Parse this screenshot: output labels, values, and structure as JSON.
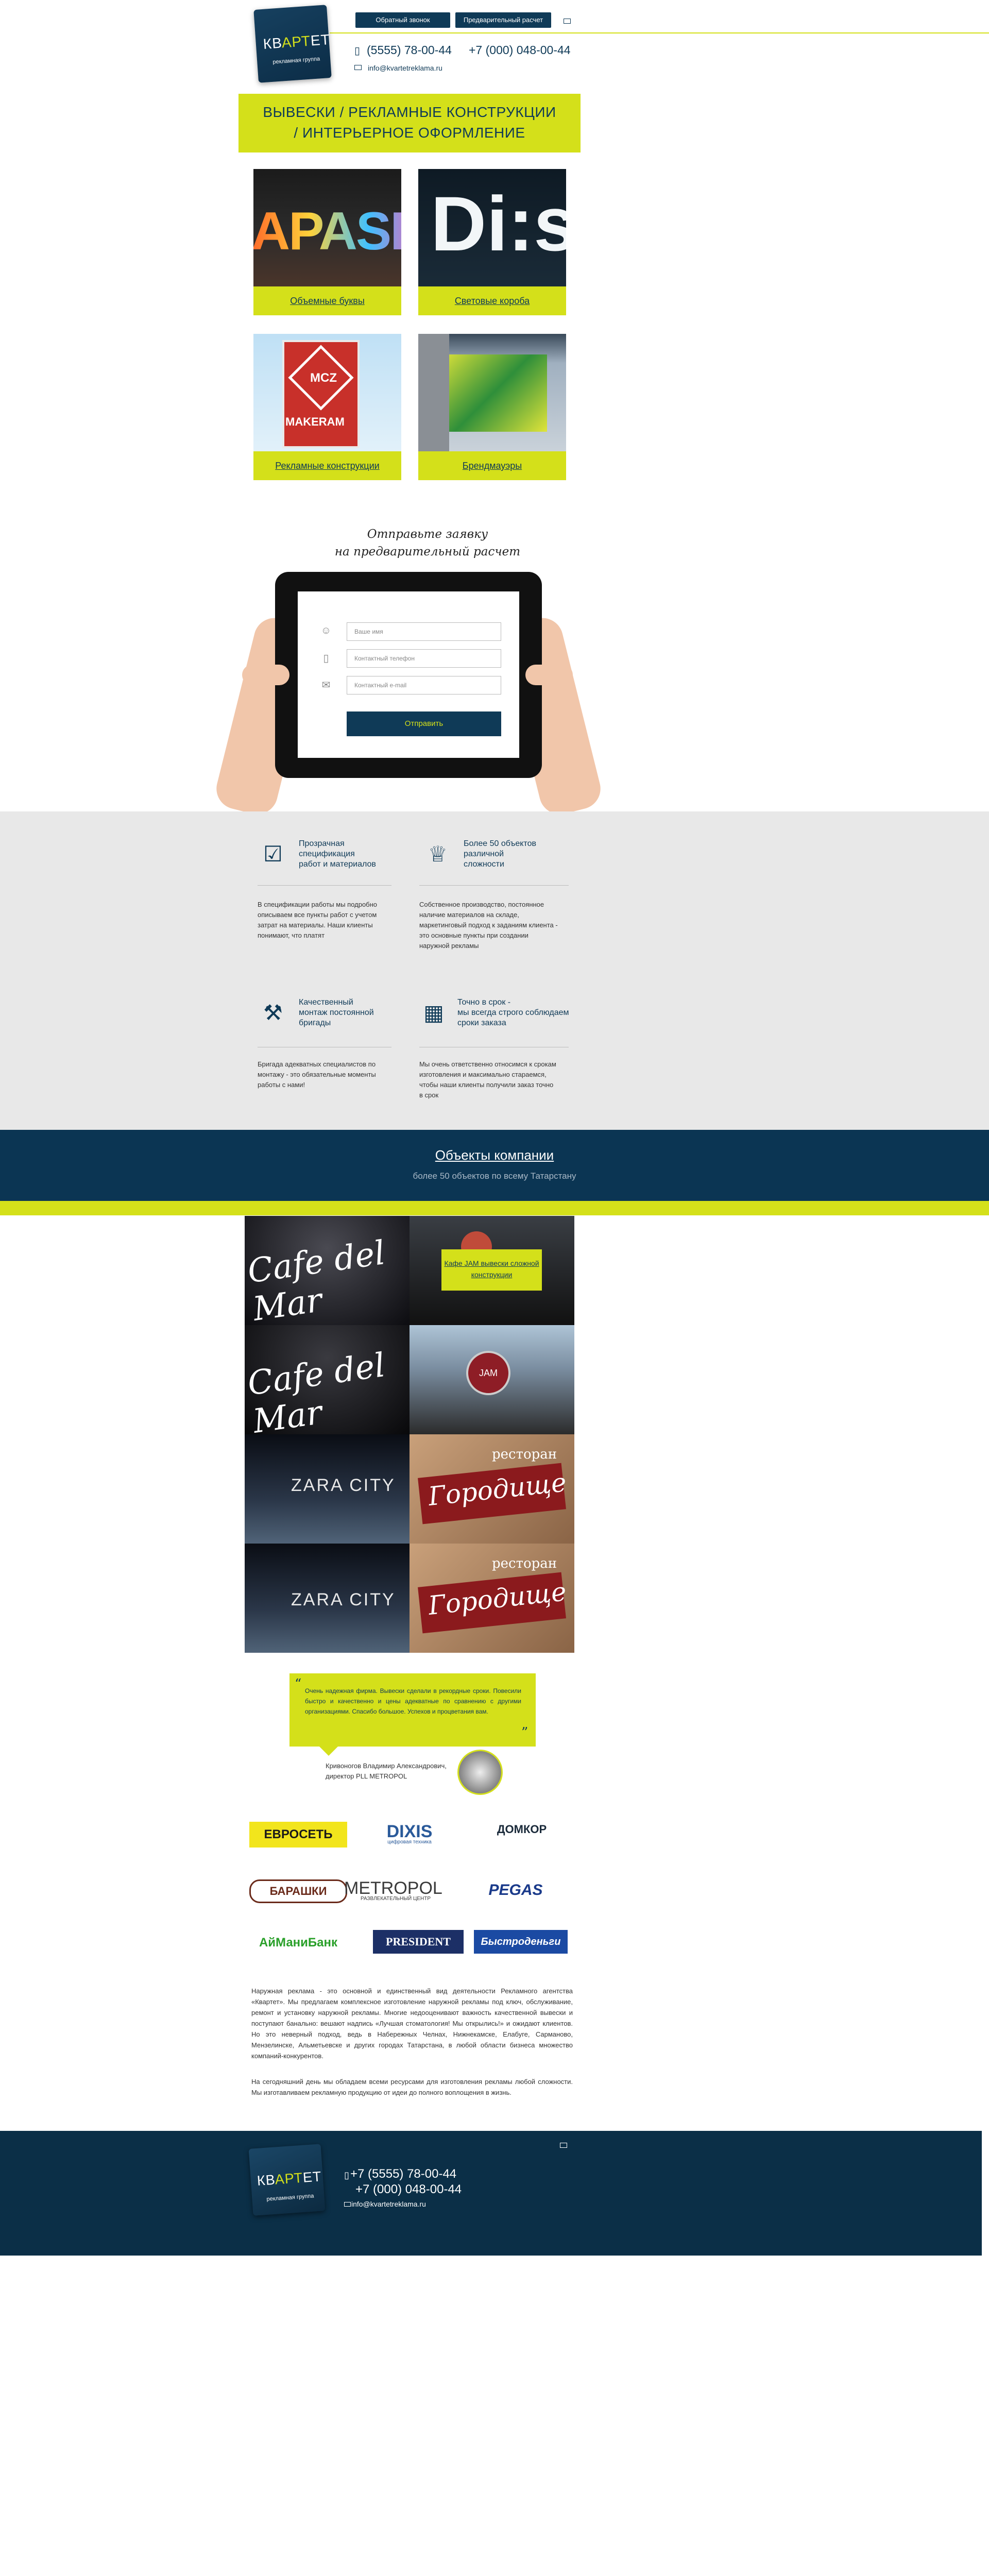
{
  "header": {
    "logo_word_a": "КВ",
    "logo_word_b": "АРТ",
    "logo_word_c": "ЕТ",
    "logo_sub": "рекламная группа",
    "callback_label": "Обратный звонок",
    "calc_label": "Предварительный расчет",
    "phone1": "(5555) 78-00-44",
    "phone2": "+7 (000) 048-00-44",
    "email": "info@kvartetreklama.ru",
    "mail_icon": "envelope-icon",
    "phone_icon": "phone-icon"
  },
  "banner": {
    "line1": "ВЫВЕСКИ  /  РЕКЛАМНЫЕ КОНСТРУКЦИИ",
    "line2": "/  ИНТЕРЬЕРНОЕ ОФОРМЛЕНИЕ"
  },
  "tiles": [
    {
      "label": "Объемные буквы",
      "text": "APASH"
    },
    {
      "label": "Световые короба",
      "text": "Di:s"
    },
    {
      "label": "Рекламные конструкции",
      "text": "MAKERAM"
    },
    {
      "label": "Брендмауэры",
      "text": ""
    }
  ],
  "form": {
    "title1": "Отправьте заявку",
    "title2": "на предварительный расчет",
    "name_placeholder": "Ваше имя",
    "phone_placeholder": "Контактный телефон",
    "email_placeholder": "Контактный e-mail",
    "submit_label": "Отправить"
  },
  "features": [
    {
      "title": "Прозрачная\nспецификация\nработ и материалов",
      "text": "В спецификации работы мы подробно описываем все пункты работ с учетом затрат на материалы. Наши клиенты понимают, что платят",
      "icon": "checklist-icon"
    },
    {
      "title": "Более 50 объектов\nразличной\nсложности",
      "text": "Собственное производство, постоянное наличие материалов на складе, маркетинговый подход к заданиям клиента - это основные пункты при создании наружной рекламы",
      "icon": "trophy-icon"
    },
    {
      "title": "Качественный\nмонтаж постоянной\nбригады",
      "text": "Бригада адекватных специалистов по монтажу - это обязательные моменты работы с нами!",
      "icon": "crane-icon"
    },
    {
      "title": "Точно в срок -\nмы всегда строго соблюдаем\nсроки заказа",
      "text": "Мы очень ответственно относимся к срокам изготовления и максимально стараемся, чтобы наши клиенты получили заказ точно в срок",
      "icon": "calendar-icon"
    }
  ],
  "objects": {
    "title": "Объекты компании",
    "subtitle": "более 50 объектов по всему Татарстану",
    "highlight_label": "Кафе JAM вывески сложной конструкции",
    "photo_texts": [
      "Cafe del Mar",
      "",
      "Cafe del Mar",
      "JAM",
      "ZARA CITY",
      "Городище",
      "ZARA CITY",
      "Городище"
    ],
    "restaurant_word": "ресторан"
  },
  "testimonial": {
    "text": "Очень надежная фирма. Вывески сделали в рекордные сроки. Повесили быстро и качественно и цены адекватные по сравнению с другими организациями. Спасибо большое. Успехов и процветания вам.",
    "author1": "Кривоногов Владимир Александрович,",
    "author2": "директор PLL METROPOL",
    "open_quote": "“",
    "close_quote": "”"
  },
  "partners": [
    "ЕВРОСЕТЬ",
    "DIXIS",
    "ДОМКОР",
    "БАРАШКИ",
    "METROPOL",
    "PEGAS",
    "АйМаниБанк",
    "PRESIDENT",
    "Быстроденьги"
  ],
  "partner_subs": [
    "",
    "цифровая техника",
    "",
    "",
    "РАЗВЛЕКАТЕЛЬНЫЙ ЦЕНТР",
    "",
    "",
    "",
    ""
  ],
  "about": {
    "p1": "Наружная реклама - это основной и единственный вид деятельности Рекламного агентства «Квартет». Мы предлагаем комплексное изготовление наружной рекламы под ключ, обслуживание, ремонт и установку наружной рекламы. Многие недооценивают важность качественной вывески и поступают банально: вешают надпись «Лучшая стоматология! Мы открылись!» и ожидают клиентов. Но это неверный подход, ведь в Набережных Челнах, Нижнекамске, Елабуге, Сарманово, Мензелинске, Альметьевске и других городах Татарстана, в любой области бизнеса множество компаний-конкурентов.",
    "p2": "На сегодняшний день мы обладаем всеми ресурсами для изготовления рекламы любой сложности. Мы изготавливаем рекламную продукцию от идеи до полного воплощения в жизнь."
  },
  "footer": {
    "logo_word_a": "КВ",
    "logo_word_b": "АРТ",
    "logo_word_c": "ЕТ",
    "logo_sub": "рекламная группа",
    "phone1": "+7 (5555) 78-00-44",
    "phone2": "+7 (000) 048-00-44",
    "email": "info@kvartetreklama.ru"
  },
  "colors": {
    "accent": "#d4e01a",
    "brand": "#0f3a57",
    "band": "#0b3553",
    "footer": "#0b2f47"
  }
}
